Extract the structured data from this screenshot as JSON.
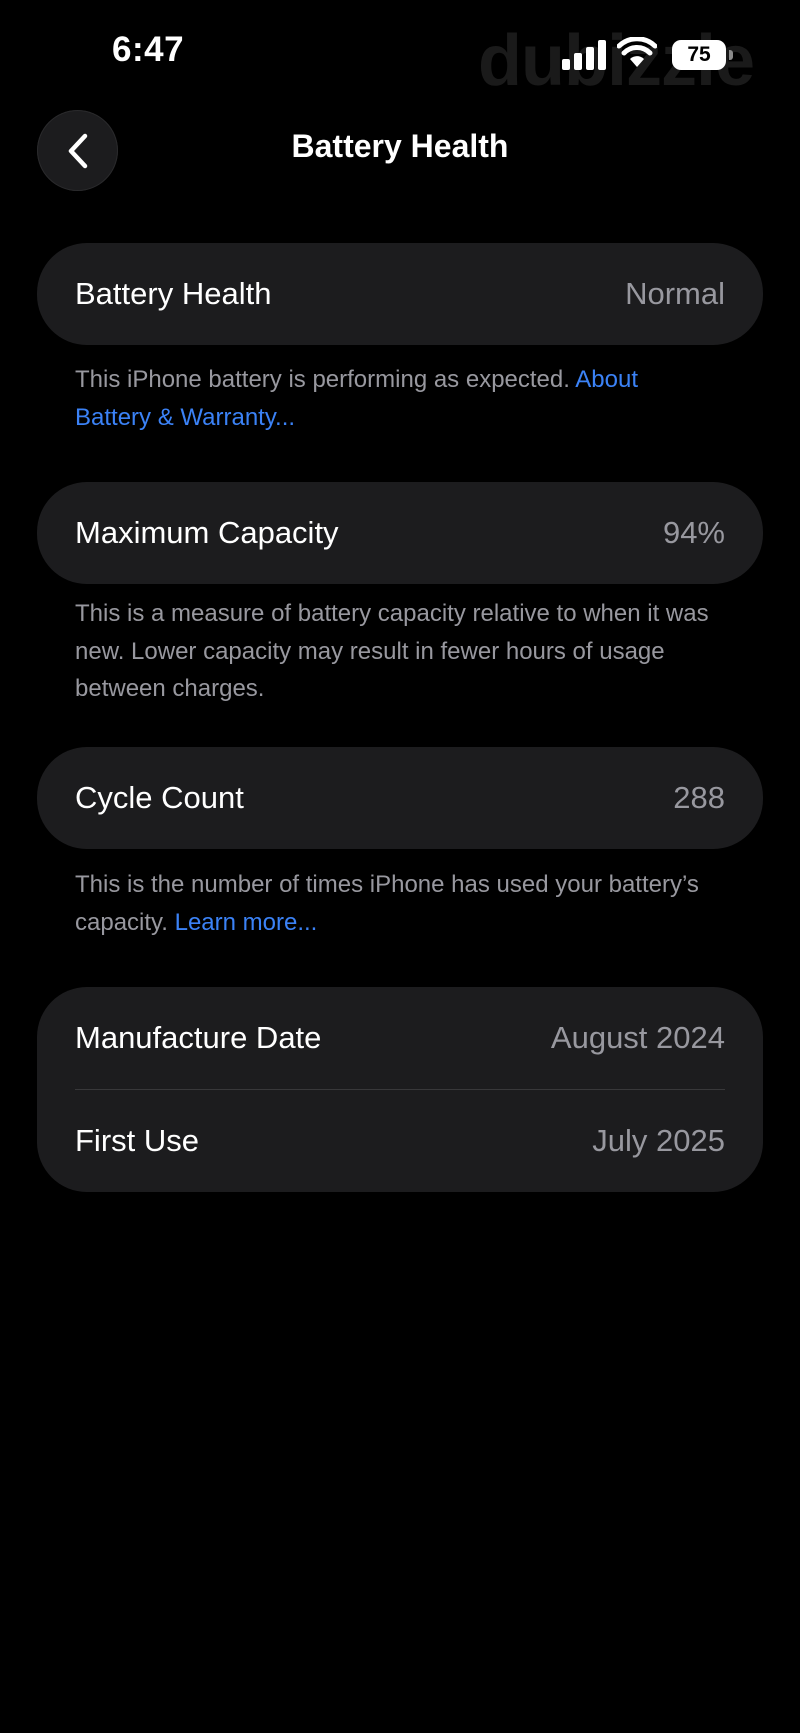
{
  "status_bar": {
    "time": "6:47",
    "battery_level": "75",
    "watermark": "dubizzle"
  },
  "nav": {
    "title": "Battery Health",
    "back_icon": "chevron-left-icon"
  },
  "battery_health": {
    "label": "Battery Health",
    "value": "Normal",
    "footnote_text": "This iPhone battery is performing as expected. ",
    "footnote_link": "About Battery & Warranty..."
  },
  "maximum_capacity": {
    "label": "Maximum Capacity",
    "value": "94%",
    "footnote_text": "This is a measure of battery capacity relative to when it was new. Lower capacity may result in fewer hours of usage between charges."
  },
  "cycle_count": {
    "label": "Cycle Count",
    "value": "288",
    "footnote_text": "This is the number of times iPhone has used your battery’s capacity. ",
    "footnote_link": "Learn more..."
  },
  "dates": {
    "manufacture_label": "Manufacture Date",
    "manufacture_value": "August 2024",
    "first_use_label": "First Use",
    "first_use_value": "July 2025"
  },
  "colors": {
    "background": "#000000",
    "card": "#1c1c1e",
    "secondary_text": "#98989f",
    "link": "#3b82f6"
  }
}
